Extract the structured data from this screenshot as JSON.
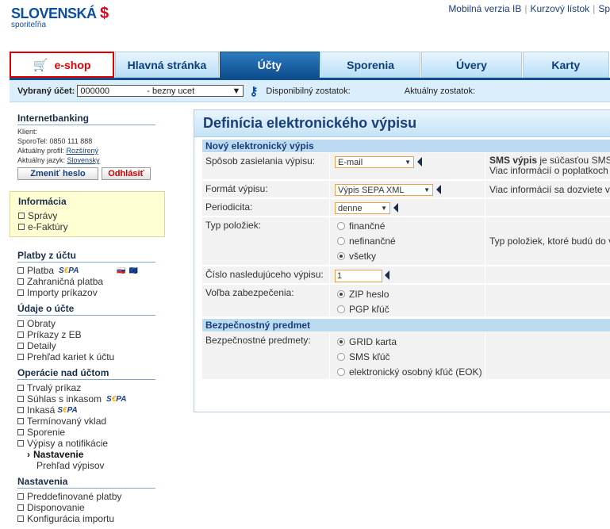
{
  "header": {
    "logo_main": "SLOVENSKÁ",
    "logo_sub": "sporiteľňa",
    "links": [
      "Mobilná verzia IB",
      "Kurzový lístok",
      "Sp"
    ]
  },
  "tabs": [
    {
      "label": "e-shop"
    },
    {
      "label": "Hlavná stránka"
    },
    {
      "label": "Účty"
    },
    {
      "label": "Sporenia"
    },
    {
      "label": "Úvery"
    },
    {
      "label": "Karty"
    }
  ],
  "account_bar": {
    "label": "Vybraný účet:",
    "account_number": "000000",
    "account_type": "- bezny ucet",
    "available": "Disponibilný zostatok:",
    "current": "Aktuálny zostatok:"
  },
  "sidebar": {
    "title": "Internetbanking",
    "client_label": "Klient:",
    "sporotel": "SporoTel: 0850 111 888",
    "profile_label": "Aktuálny profil:",
    "profile_value": "Rozšírený",
    "language_label": "Aktuálny jazyk:",
    "language_value": "Slovensky",
    "change_password": "Zmeniť heslo",
    "logout": "Odhlásiť",
    "info_title": "Informácia",
    "info_items": [
      "Správy",
      "e-Faktúry"
    ],
    "sections": {
      "platby": {
        "title": "Platby z účtu",
        "items": [
          "Platba",
          "Zahraničná platba",
          "Importy príkazov"
        ]
      },
      "udaje": {
        "title": "Údaje o účte",
        "items": [
          "Obraty",
          "Príkazy z EB",
          "Detaily",
          "Prehľad kariet k účtu"
        ]
      },
      "operacie": {
        "title": "Operácie nad účtom",
        "items": [
          "Trvalý príkaz",
          "Súhlas s inkasom",
          "Inkasá",
          "Termínovaný vklad",
          "Sporenie",
          "Výpisy a notifikácie"
        ],
        "sub_active": "Nastavenie",
        "sub_other": "Prehľad výpisov"
      },
      "nastavenia": {
        "title": "Nastavenia",
        "items": [
          "Preddefinované platby",
          "Disponovanie",
          "Konfigurácia importu"
        ]
      }
    },
    "sepa_prefix": "S",
    "sepa_e": "€",
    "sepa_suffix": "PA"
  },
  "main": {
    "title": "Definícia elektronického výpisu",
    "section1": "Nový elektronický výpis",
    "fields": {
      "sposob": {
        "label": "Spôsob zasielania výpisu:",
        "value": "E-mail",
        "hint_bold": "SMS výpis",
        "hint_rest": " je súčasťou SMS",
        "hint2": "Viac informácií o poplatkoch"
      },
      "format": {
        "label": "Formát výpisu:",
        "value": "Výpis SEPA XML",
        "hint": "Viac informácií sa dozviete v"
      },
      "periodicita": {
        "label": "Periodicita:",
        "value": "denne"
      },
      "typ": {
        "label": "Typ položiek:",
        "options": [
          "finančné",
          "nefinančné",
          "všetky"
        ],
        "selected": "všetky",
        "hint": "Typ položiek, ktoré budú do v"
      },
      "cislo": {
        "label": "Číslo nasledujúceho výpisu:",
        "value": "1"
      },
      "zabezpecenie": {
        "label": "Voľba zabezpečenia:",
        "options": [
          "ZIP heslo",
          "PGP kľúč"
        ],
        "selected": "ZIP heslo"
      }
    },
    "section2": "Bezpečnostný predmet",
    "security": {
      "label": "Bezpečnostné predmety:",
      "options": [
        "GRID karta",
        "SMS kľúč",
        "elektronický osobný kľúč (EOK)"
      ],
      "selected": "GRID karta"
    }
  }
}
